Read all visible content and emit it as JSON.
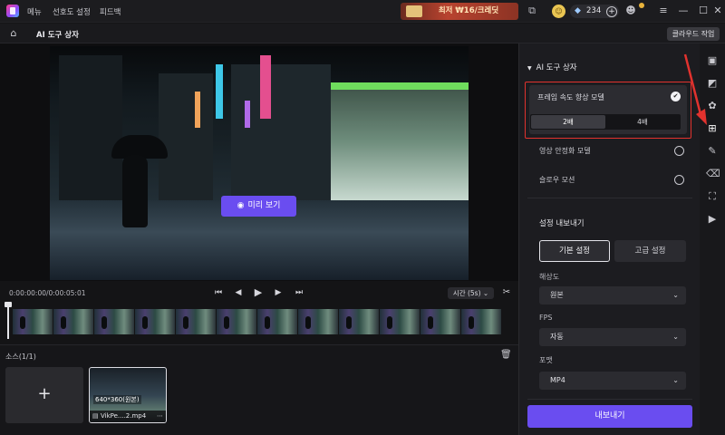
{
  "menu": {
    "items": [
      "메뉴",
      "선호도 설정",
      "피드백"
    ]
  },
  "promo": {
    "text": "최저 ₩16/크레딧"
  },
  "credits": {
    "value": "234"
  },
  "header": {
    "title": "AI 도구 상자",
    "cloud_button": "클라우드 작업"
  },
  "preview": {
    "button_label": "미리 보기"
  },
  "timeline": {
    "timecode": "0:00:00:00/0:00:05:01",
    "speed_label": "시간 (5s)"
  },
  "source": {
    "title": "소스(1/1)",
    "add_label": "+",
    "clip": {
      "resolution": "640*360(원본)",
      "name": "VikPe....2.mp4"
    }
  },
  "panel": {
    "section_title": "AI 도구 상자",
    "feature": {
      "label": "프레임 속도 향상 모델",
      "options": [
        "2배",
        "4배"
      ]
    },
    "options": [
      "영상 안정화 모델",
      "슬로우 모션"
    ],
    "export": {
      "title": "설정 내보내기",
      "tab_basic": "기본 설정",
      "tab_advanced": "고급 설정",
      "fields": [
        {
          "label": "해상도",
          "value": "원본"
        },
        {
          "label": "FPS",
          "value": "자동"
        },
        {
          "label": "포맷",
          "value": "MP4"
        }
      ],
      "button": "내보내기"
    }
  },
  "colors": {
    "accent": "#6a4df0",
    "highlight": "#e2322e"
  }
}
